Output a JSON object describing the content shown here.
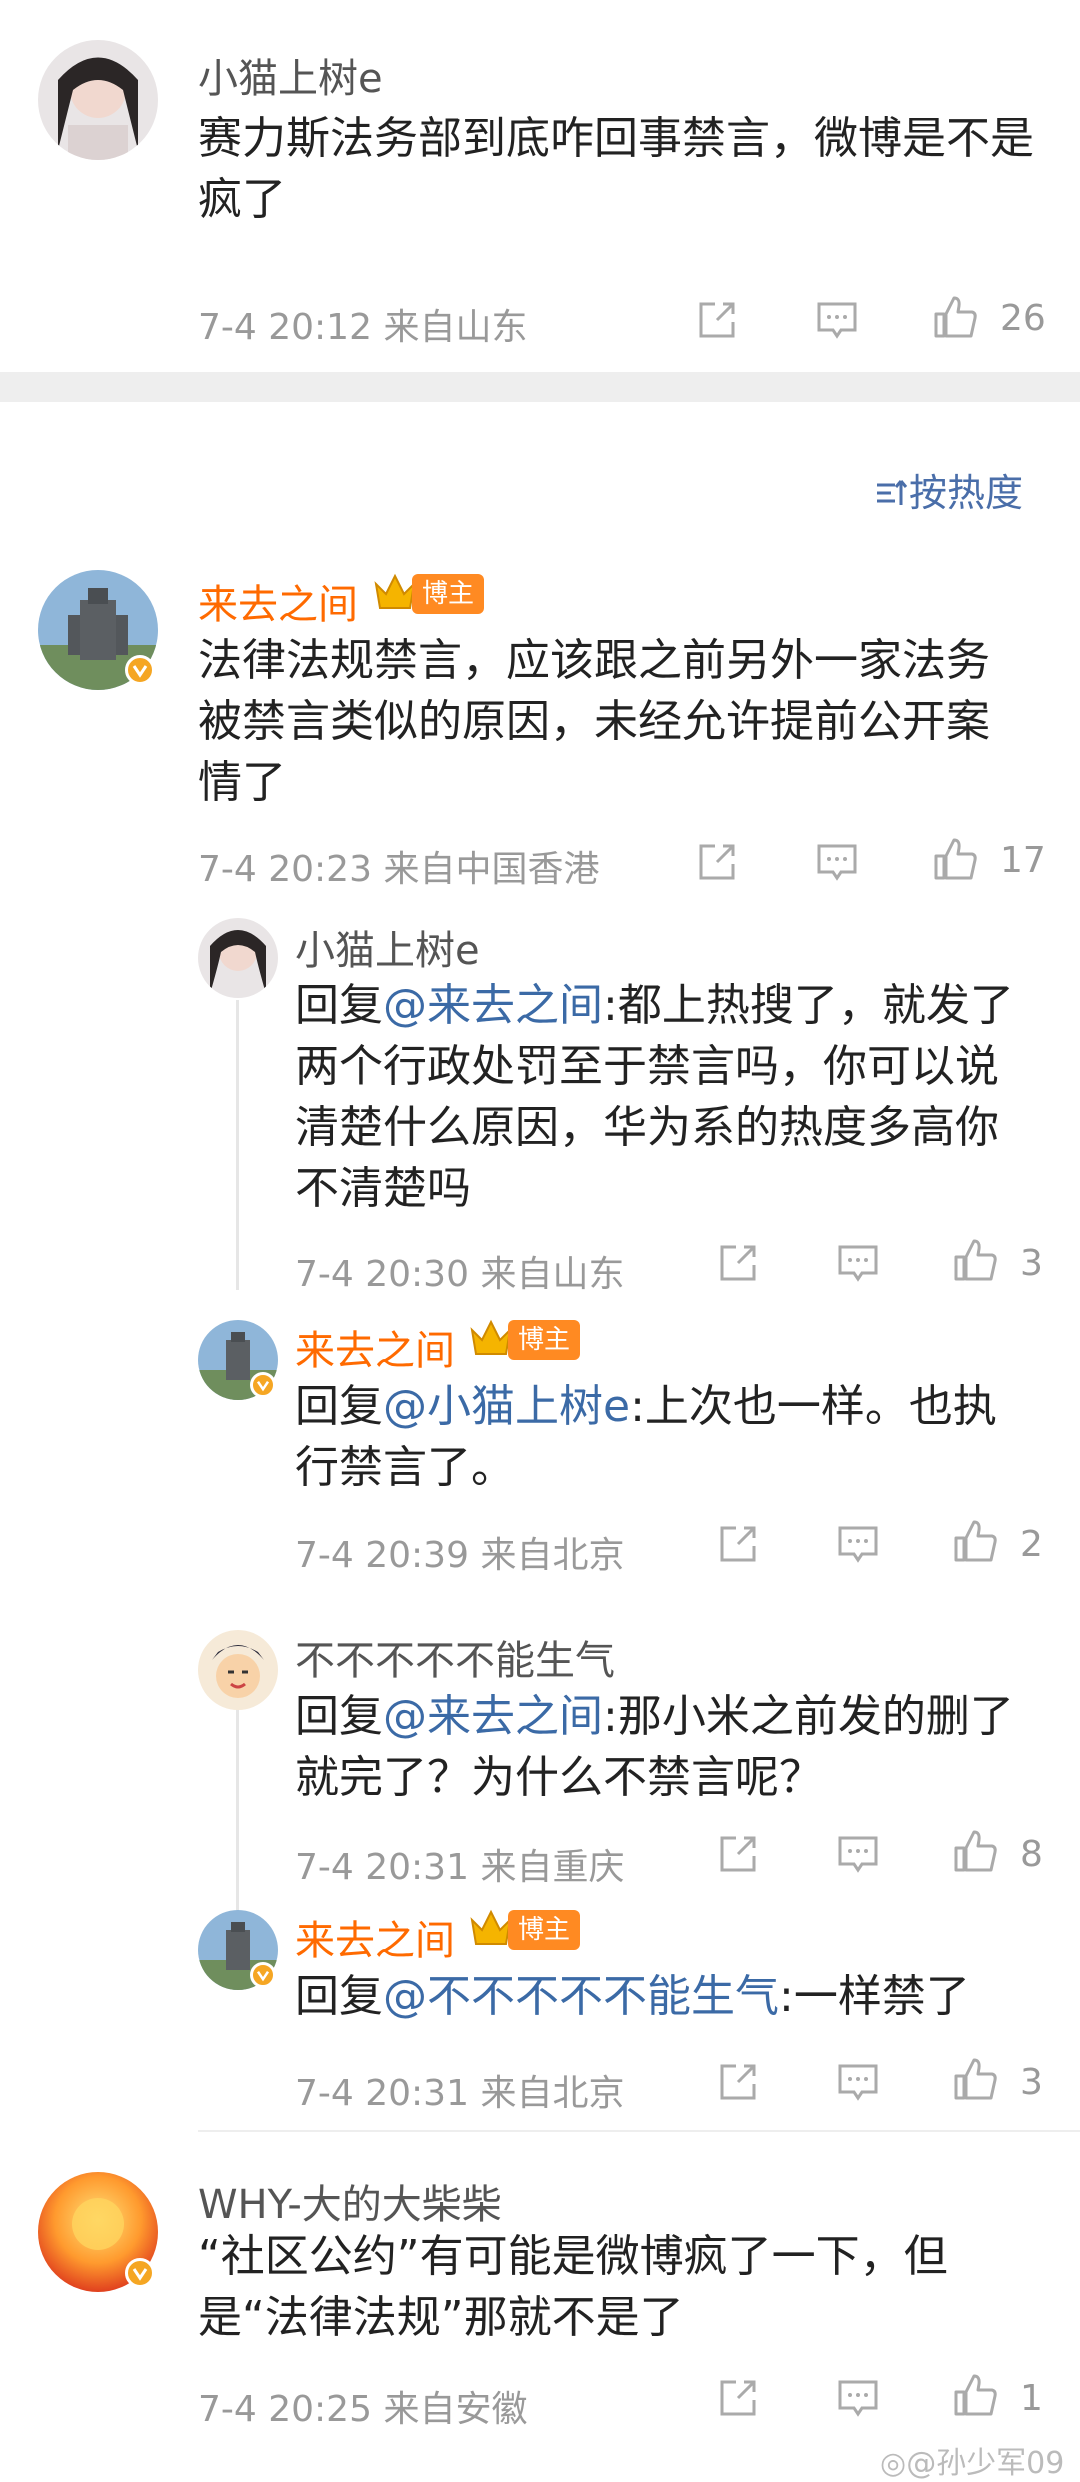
{
  "comments": [
    {
      "name": "小猫上树e",
      "text": "赛力斯法务部到底咋回事禁言，微博是不是疯了",
      "time": "7-4 20:12",
      "location": "来自山东",
      "likes": "26"
    },
    {
      "name": "来去之间",
      "badge": "博主",
      "text": "法律法规禁言，应该跟之前另外一家法务被禁言类似的原因，未经允许提前公开案情了",
      "time": "7-4 20:23",
      "location": "来自中国香港",
      "likes": "17",
      "replies": [
        {
          "name": "小猫上树e",
          "reply_prefix": "回复",
          "mention": "@来去之间",
          "text": ":都上热搜了，就发了两个行政处罚至于禁言吗，你可以说清楚什么原因，华为系的热度多高你不清楚吗",
          "time": "7-4 20:30",
          "location": "来自山东",
          "likes": "3"
        },
        {
          "name": "来去之间",
          "badge": "博主",
          "reply_prefix": "回复",
          "mention": "@小猫上树e",
          "text": ":上次也一样。也执行禁言了。",
          "time": "7-4 20:39",
          "location": "来自北京",
          "likes": "2"
        },
        {
          "name": "不不不不不能生气",
          "reply_prefix": "回复",
          "mention": "@来去之间",
          "text": ":那小米之前发的删了就完了？为什么不禁言呢？",
          "time": "7-4 20:31",
          "location": "来自重庆",
          "likes": "8"
        },
        {
          "name": "来去之间",
          "badge": "博主",
          "reply_prefix": "回复",
          "mention": "@不不不不不能生气",
          "text": ":一样禁了",
          "time": "7-4 20:31",
          "location": "来自北京",
          "likes": "3"
        }
      ]
    },
    {
      "name": "WHY-大的大柴柴",
      "text": "“社区公约”有可能是微博疯了一下，但是“法律法规”那就不是了",
      "time": "7-4 20:25",
      "location": "来自安徽",
      "likes": "1"
    }
  ],
  "sort_label": "按热度",
  "watermark": "@孙少军09",
  "colors": {
    "accent_orange": "#ff6a00",
    "mention_blue": "#3b6aa6",
    "meta_gray": "#999999",
    "divider": "#eeeeee"
  }
}
